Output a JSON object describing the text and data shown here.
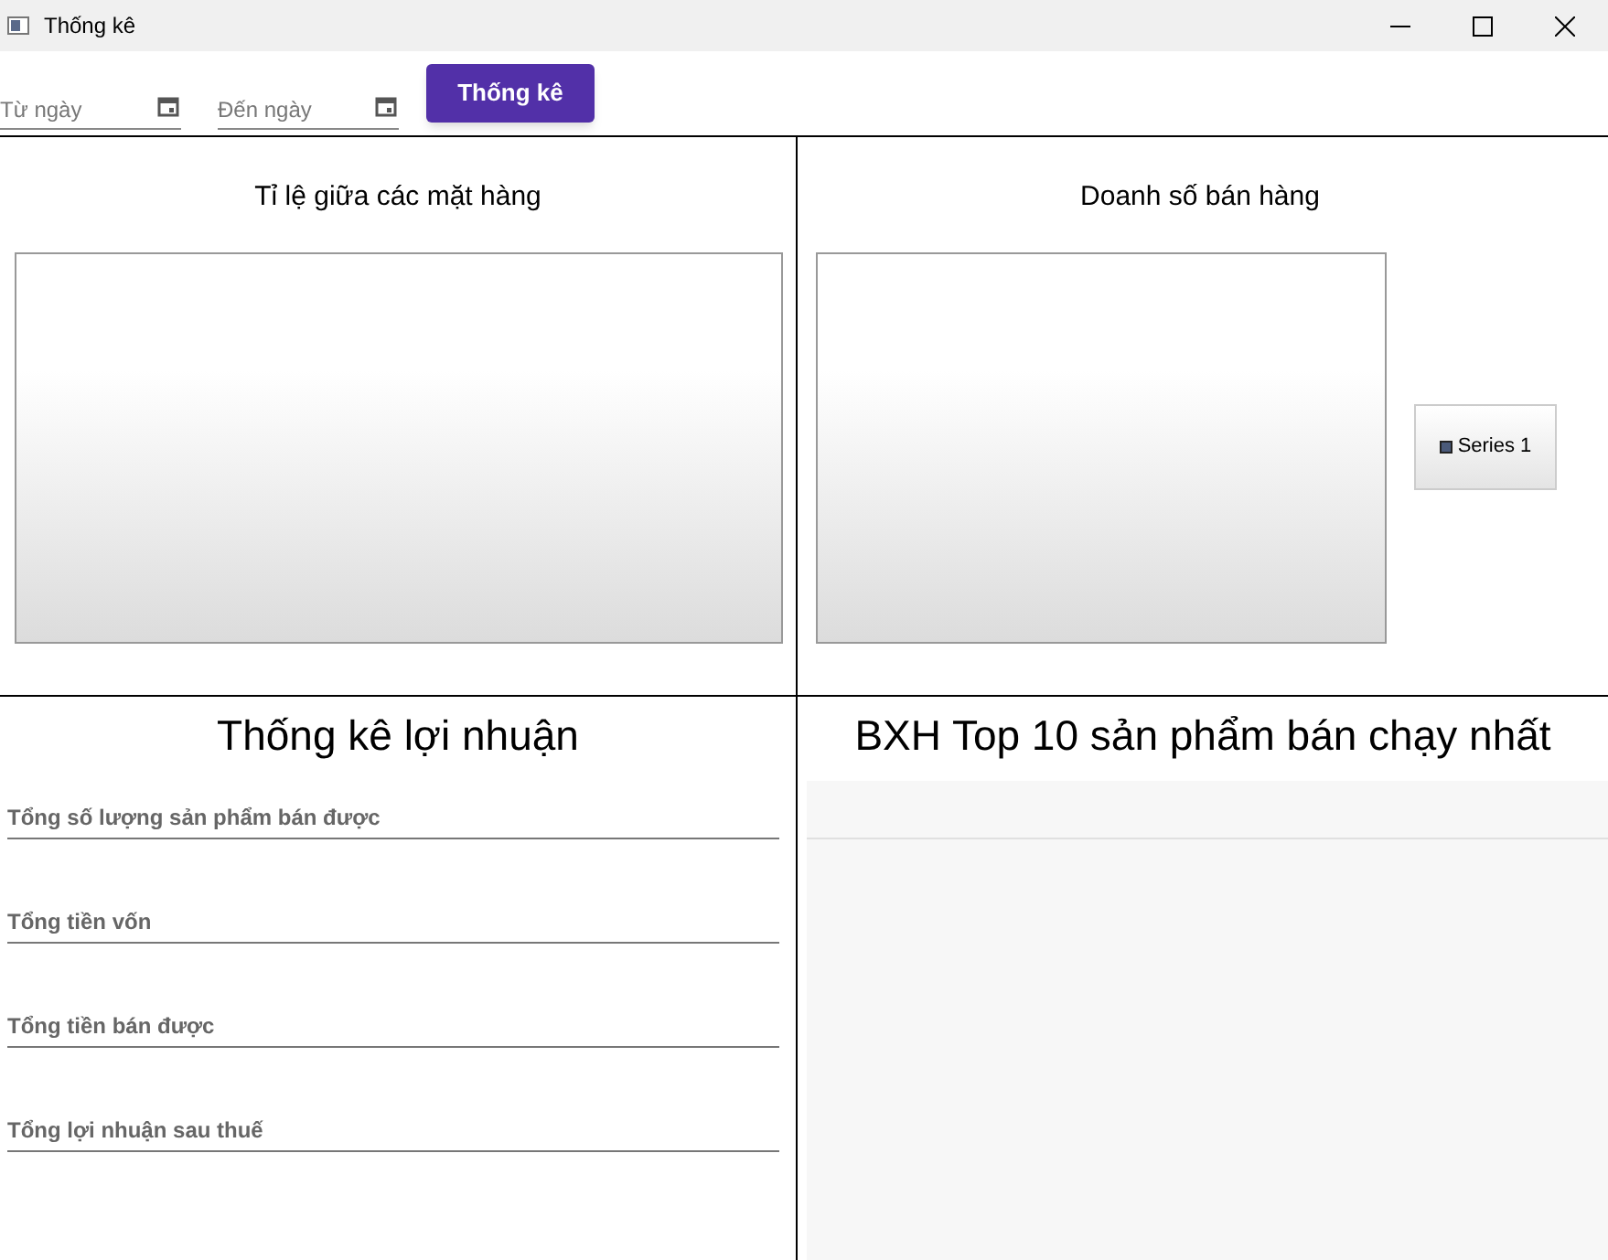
{
  "window": {
    "title": "Thống kê"
  },
  "toolbar": {
    "from_date": {
      "placeholder": "Từ ngày"
    },
    "to_date": {
      "placeholder": "Đến ngày"
    },
    "button": "Thống kê"
  },
  "ratio_panel": {
    "title": "Tỉ lệ giữa các mặt hàng"
  },
  "sales_panel": {
    "title": "Doanh số bán hàng",
    "legend": [
      "Series 1"
    ]
  },
  "profit_panel": {
    "title": "Thống kê lợi nhuận",
    "fields": [
      {
        "placeholder": "Tổng số lượng sản phẩm bán được"
      },
      {
        "placeholder": "Tổng tiền vốn"
      },
      {
        "placeholder": "Tổng tiền bán được"
      },
      {
        "placeholder": "Tổng lợi nhuận sau thuế"
      }
    ]
  },
  "top_panel": {
    "title": "BXH Top 10 sản phẩm bán chạy nhất"
  }
}
